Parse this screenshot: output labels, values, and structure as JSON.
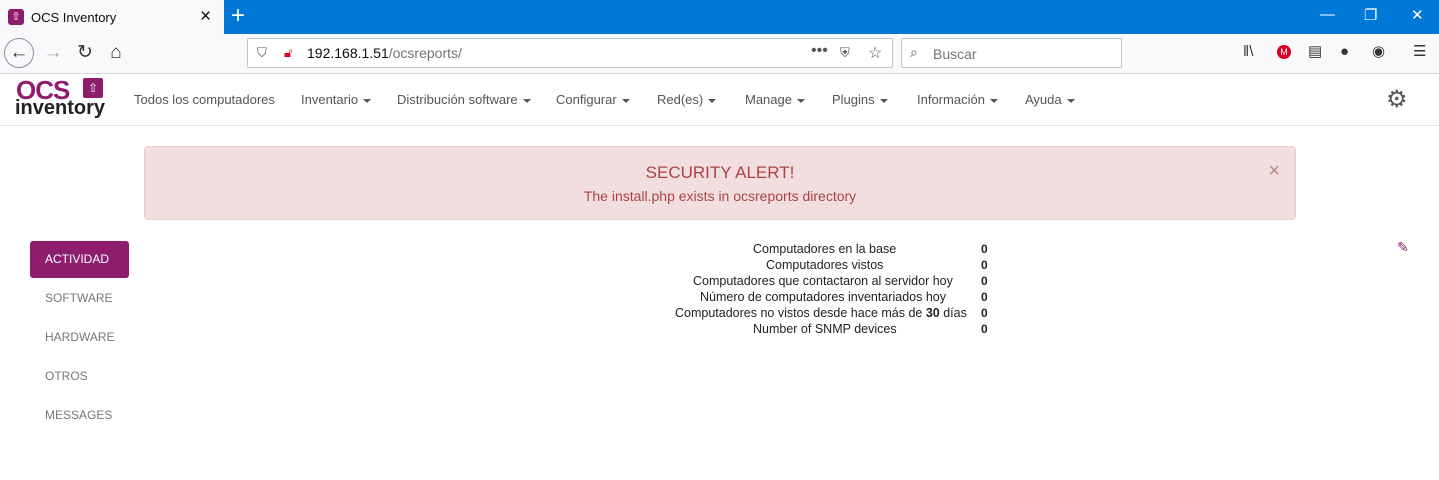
{
  "browser": {
    "tab_title": "OCS Inventory",
    "url_host": "192.168.1.51",
    "url_path": "/ocsreports/",
    "search_placeholder": "Buscar"
  },
  "app": {
    "logo_top": "OCS",
    "logo_bottom": "inventory",
    "menu": [
      "Todos los computadores",
      "Inventario",
      "Distribución software",
      "Configurar",
      "Red(es)",
      "Manage",
      "Plugins",
      "Información",
      "Ayuda"
    ]
  },
  "alert": {
    "title": "SECURITY ALERT!",
    "message": "The install.php exists in ocsreports directory"
  },
  "sidebar": {
    "items": [
      "ACTIVIDAD",
      "SOFTWARE",
      "HARDWARE",
      "OTROS",
      "MESSAGES"
    ]
  },
  "stats": [
    {
      "label": "Computadores en la base",
      "value": "0"
    },
    {
      "label": "Computadores vistos",
      "value": "0"
    },
    {
      "label": "Computadores que contactaron al servidor hoy",
      "value": "0"
    },
    {
      "label": "Número de computadores inventariados hoy",
      "value": "0"
    },
    {
      "label_pre": "Computadores no vistos desde hace más de ",
      "label_num": "30",
      "label_post": " días",
      "value": "0"
    },
    {
      "label": "Number of SNMP devices",
      "value": "0"
    }
  ],
  "colors": {
    "brand": "#8e1d6e",
    "titlebar": "#0078d7",
    "alert_bg": "#f2dede",
    "alert_text": "#a94442"
  }
}
